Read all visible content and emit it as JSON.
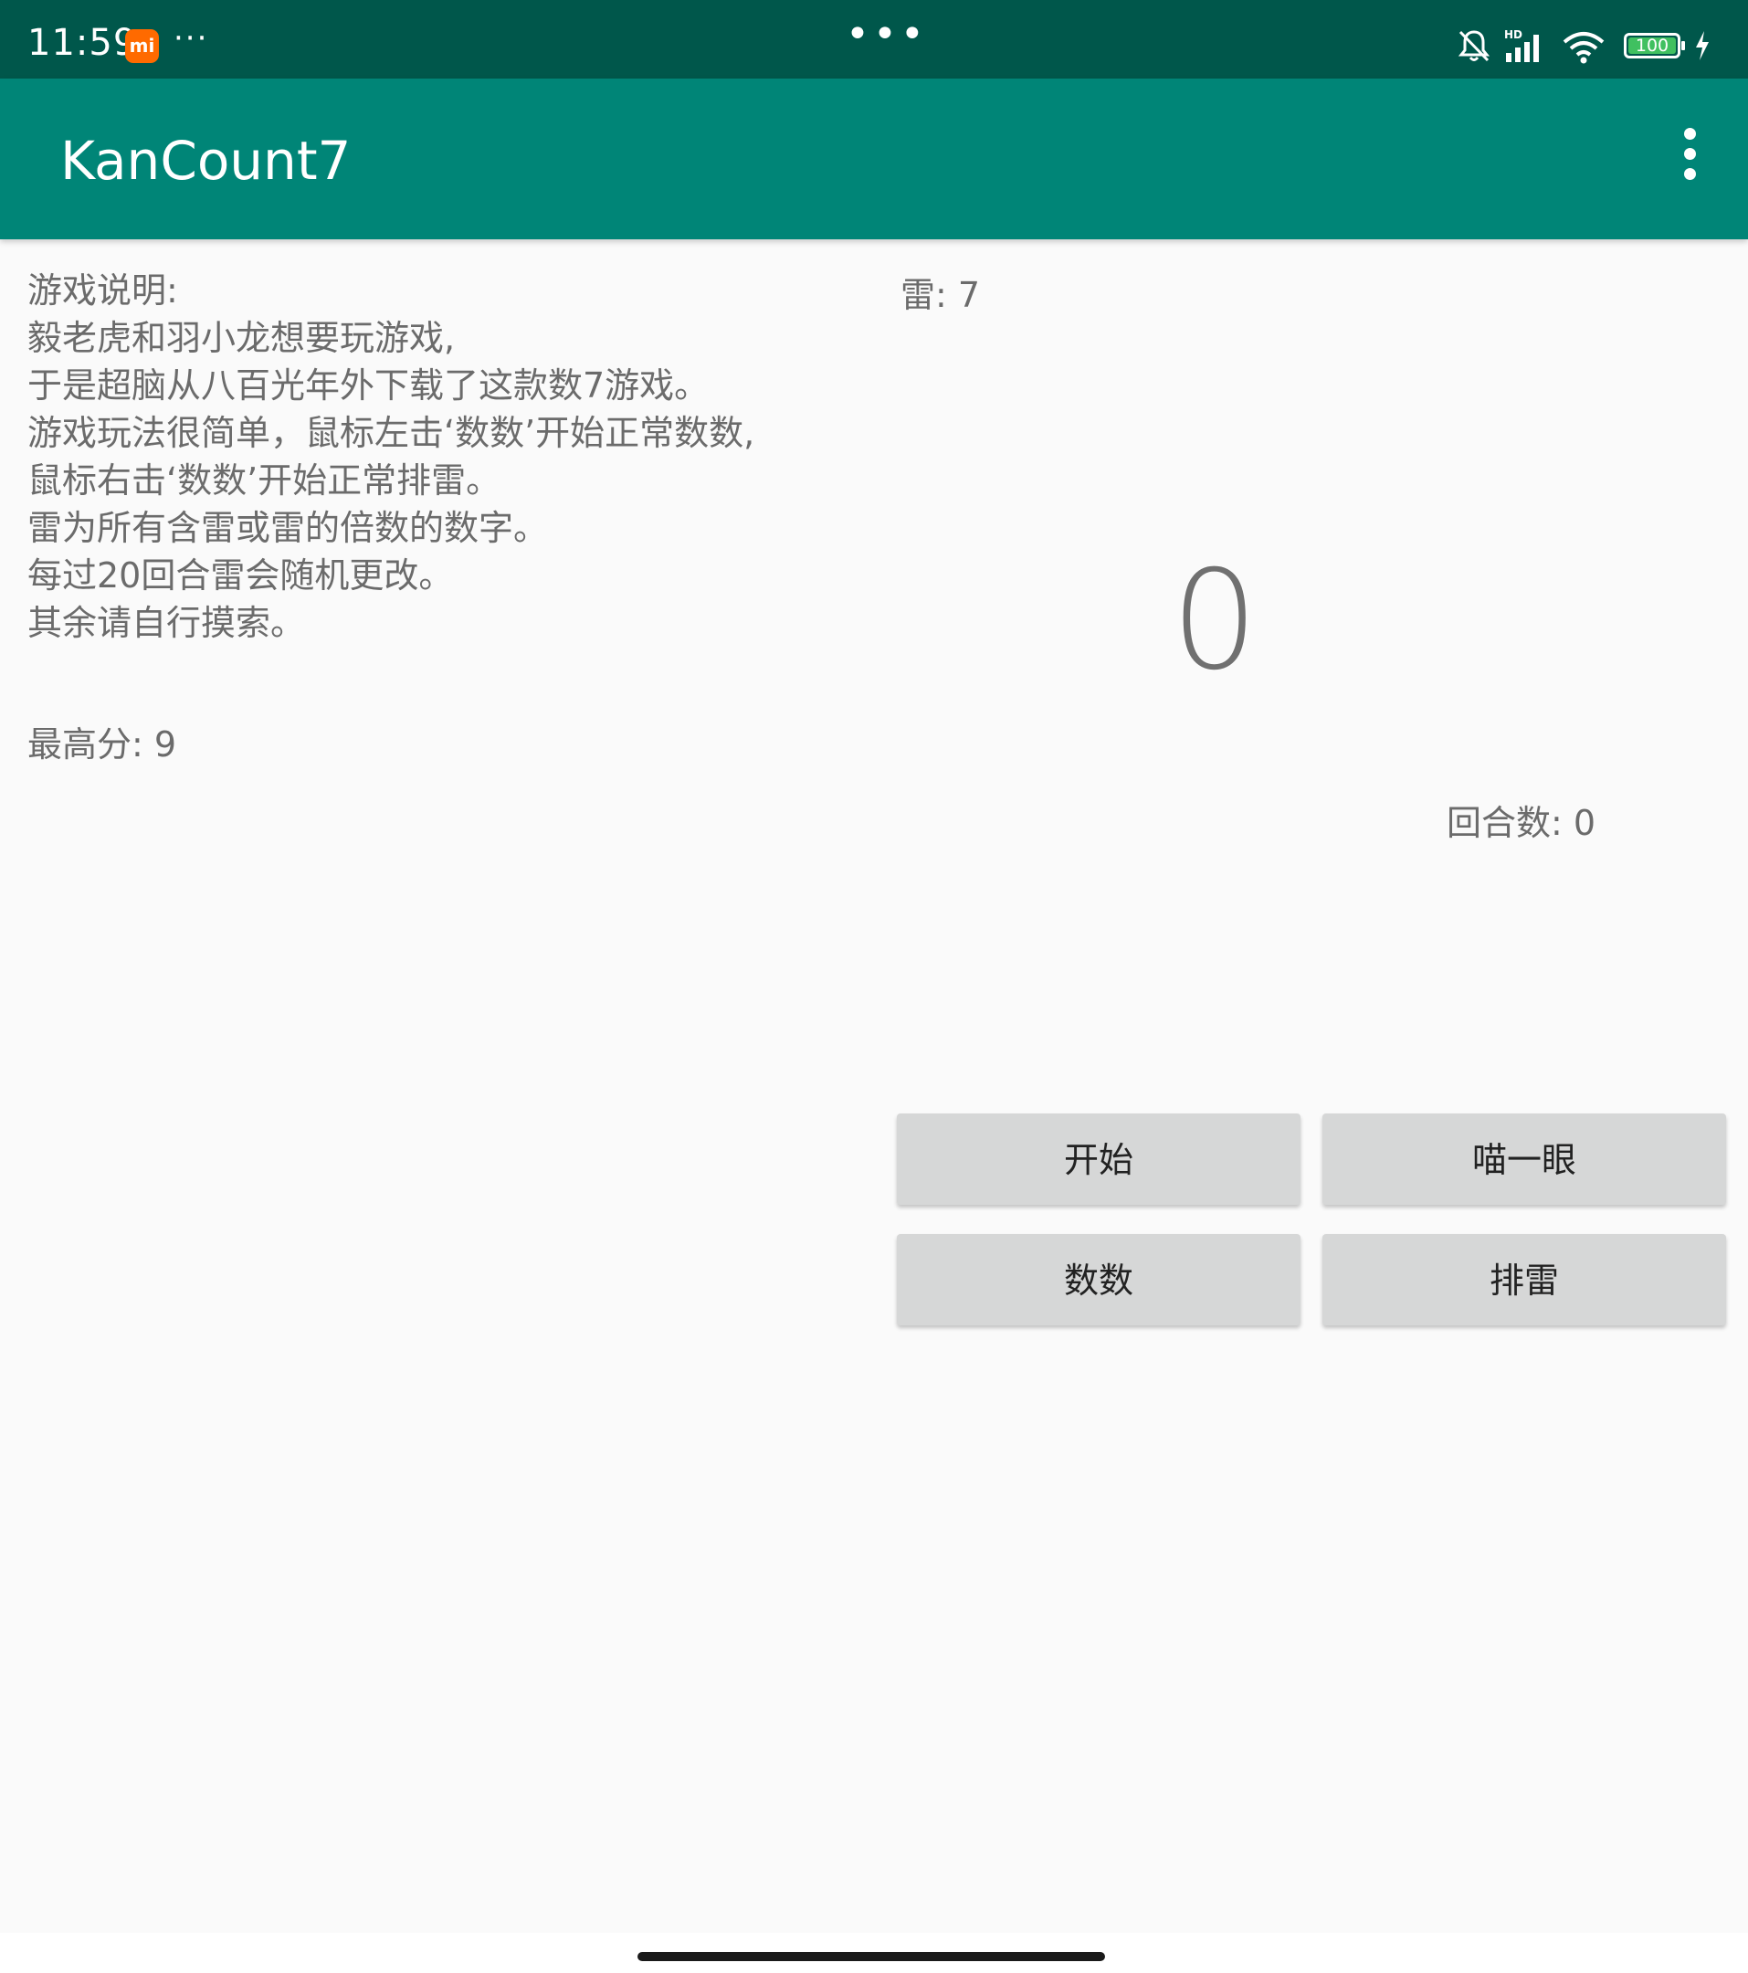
{
  "status_bar": {
    "time": "11:59",
    "mi_badge": "mi",
    "more": "···",
    "center_dots": "•••",
    "battery_level": "100",
    "battery_color": "#40c060",
    "icons": [
      "bell-off-icon",
      "signal-hd-icon",
      "wifi-icon",
      "battery-icon",
      "charging-bolt-icon"
    ]
  },
  "app_bar": {
    "title": "KanCount7",
    "background": "#008577",
    "overflow_icon": "more-vert-icon"
  },
  "instructions": {
    "lines": [
      "游戏说明:",
      "毅老虎和羽小龙想要玩游戏,",
      "于是超脑从八百光年外下载了这款数7游戏。",
      "游戏玩法很简单，鼠标左击‘数数’开始正常数数,",
      "鼠标右击‘数数’开始正常排雷。",
      "雷为所有含雷或雷的倍数的数字。",
      "每过20回合雷会随机更改。",
      "其余请自行摸索。"
    ]
  },
  "high_score": "最高分: 9",
  "mine": "雷: 7",
  "current_count": "0",
  "round_count": "回合数: 0",
  "buttons": {
    "start": "开始",
    "peek": "喵一眼",
    "count": "数数",
    "mine": "排雷"
  }
}
